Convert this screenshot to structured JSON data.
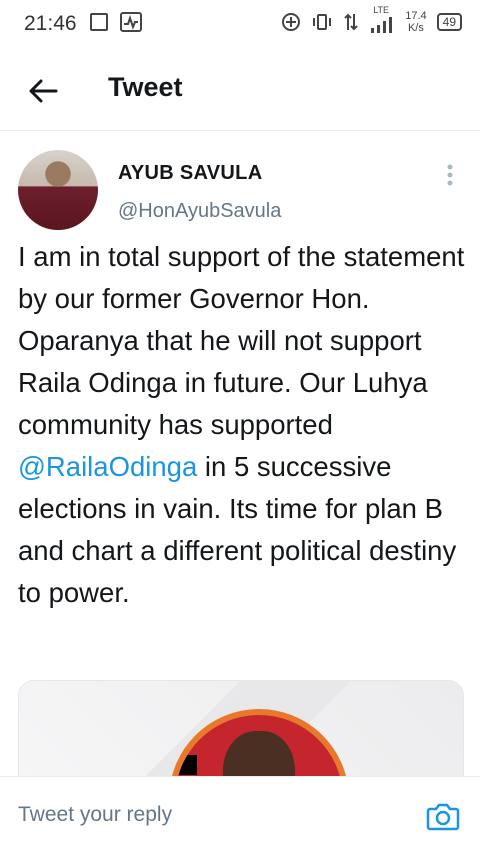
{
  "status_bar": {
    "time": "21:46",
    "network_type": "LTE",
    "speed_value": "17.4",
    "speed_unit": "K/s",
    "battery": "49",
    "icons": [
      "notes-icon",
      "pulse-icon",
      "data-saver-icon",
      "vibrate-icon",
      "data-arrows-icon",
      "signal-icon",
      "battery-icon"
    ]
  },
  "header": {
    "back_icon": "arrow-left-icon",
    "title": "Tweet"
  },
  "tweet": {
    "author_name": "AYUB SAVULA",
    "author_handle": "@HonAyubSavula",
    "text_before_mention": "I am in total support of the statement by our former Governor Hon. Oparanya that he will not support Raila Odinga in future. Our Luhya community has supported ",
    "mention": "@RailaOdinga",
    "text_after_mention": " in 5 successive elections in vain. Its time for plan B and chart a different political destiny to power.",
    "more_icon": "more-vertical-icon"
  },
  "reply": {
    "placeholder": "Tweet your reply",
    "camera_icon": "camera-icon"
  },
  "colors": {
    "accent": "#1b95e0",
    "text": "#14171a",
    "secondary": "#657786"
  }
}
